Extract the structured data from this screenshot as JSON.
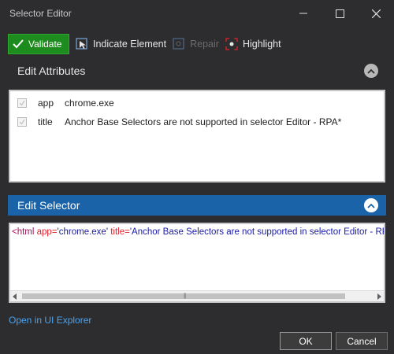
{
  "window": {
    "title": "Selector Editor"
  },
  "toolbar": {
    "validate_label": "Validate",
    "indicate_label": "Indicate Element",
    "repair_label": "Repair",
    "highlight_label": "Highlight"
  },
  "attributes": {
    "header": "Edit Attributes",
    "rows": [
      {
        "name": "app",
        "value": "chrome.exe",
        "checked": true
      },
      {
        "name": "title",
        "value": "Anchor Base Selectors are not supported in selector Editor - RPA*",
        "checked": true
      }
    ]
  },
  "selector": {
    "header": "Edit Selector",
    "tokens": {
      "open": "<html ",
      "attr1": "app=",
      "val1": "'chrome.exe'",
      "sep": " ",
      "attr2": "title=",
      "val2": "'Anchor Base Selectors are not supported in selector Editor - RPA*' />"
    }
  },
  "footer": {
    "explorer_link": "Open in UI Explorer",
    "ok_label": "OK",
    "cancel_label": "Cancel"
  },
  "colors": {
    "validate_bg": "#1e8b1e",
    "selector_header_bg": "#1a63a8",
    "link": "#4aa3f0",
    "highlight_accent": "#e0212e"
  }
}
